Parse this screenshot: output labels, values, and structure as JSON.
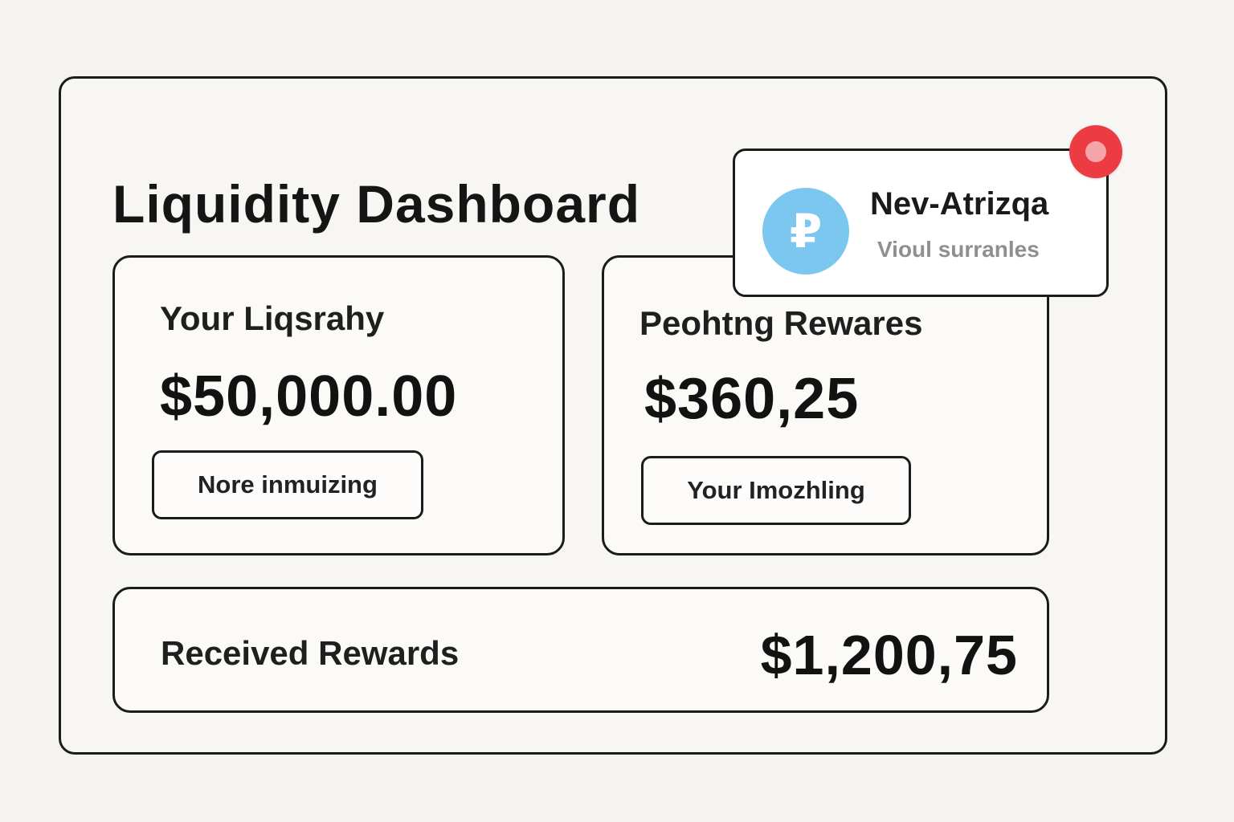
{
  "dashboard": {
    "title": "Liquidity Dashboard"
  },
  "cards": {
    "your_liquidity": {
      "label": "Your Liqsrahy",
      "value": "$50,000.00",
      "button_label": "Nore inmuizing"
    },
    "pending_rewards": {
      "label": "Peohtng Rewares",
      "value": "$360,25",
      "button_label": "Your Imozhling"
    },
    "received_rewards": {
      "label": "Received Rewards",
      "value": "$1,200,75"
    }
  },
  "notification": {
    "icon": "ruble-icon",
    "icon_glyph": "₽",
    "title": "Nev-Atrizqa",
    "subtitle": "Vioul surranles",
    "badge_color": "#ec3b43",
    "icon_color": "#7cc7ef"
  }
}
